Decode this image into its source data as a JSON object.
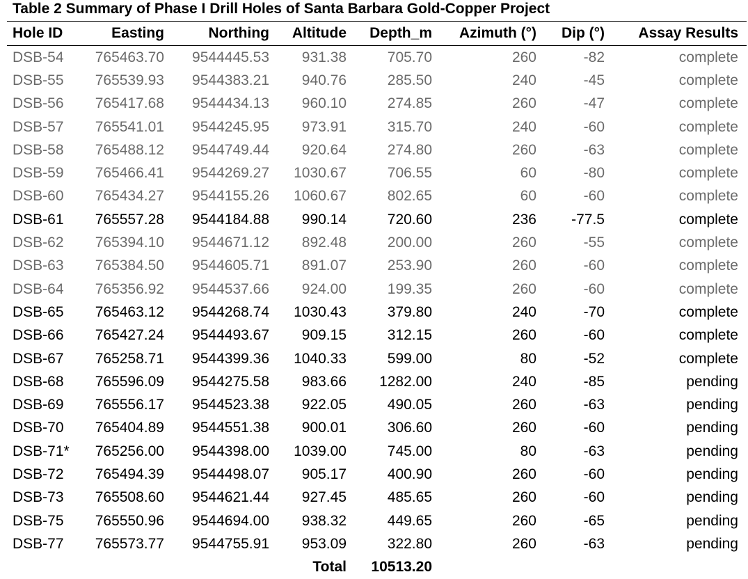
{
  "title": "Table 2 Summary of Phase I Drill Holes of Santa Barbara Gold-Copper Project",
  "headers": [
    "Hole ID",
    "Easting",
    "Northing",
    "Altitude",
    "Depth_m",
    "Azimuth (°)",
    "Dip (°)",
    "Assay Results"
  ],
  "rows": [
    {
      "id": "DSB-54",
      "easting": "765463.70",
      "northing": "9544445.53",
      "altitude": "931.38",
      "depth": "705.70",
      "azimuth": "260",
      "dip": "-82",
      "assay": "complete",
      "muted": true
    },
    {
      "id": "DSB-55",
      "easting": "765539.93",
      "northing": "9544383.21",
      "altitude": "940.76",
      "depth": "285.50",
      "azimuth": "240",
      "dip": "-45",
      "assay": "complete",
      "muted": true
    },
    {
      "id": "DSB-56",
      "easting": "765417.68",
      "northing": "9544434.13",
      "altitude": "960.10",
      "depth": "274.85",
      "azimuth": "260",
      "dip": "-47",
      "assay": "complete",
      "muted": true
    },
    {
      "id": "DSB-57",
      "easting": "765541.01",
      "northing": "9544245.95",
      "altitude": "973.91",
      "depth": "315.70",
      "azimuth": "240",
      "dip": "-60",
      "assay": "complete",
      "muted": true
    },
    {
      "id": "DSB-58",
      "easting": "765488.12",
      "northing": "9544749.44",
      "altitude": "920.64",
      "depth": "274.80",
      "azimuth": "260",
      "dip": "-63",
      "assay": "complete",
      "muted": true
    },
    {
      "id": "DSB-59",
      "easting": "765466.41",
      "northing": "9544269.27",
      "altitude": "1030.67",
      "depth": "706.55",
      "azimuth": "60",
      "dip": "-80",
      "assay": "complete",
      "muted": true
    },
    {
      "id": "DSB-60",
      "easting": "765434.27",
      "northing": "9544155.26",
      "altitude": "1060.67",
      "depth": "802.65",
      "azimuth": "60",
      "dip": "-60",
      "assay": "complete",
      "muted": true
    },
    {
      "id": "DSB-61",
      "easting": "765557.28",
      "northing": "9544184.88",
      "altitude": "990.14",
      "depth": "720.60",
      "azimuth": "236",
      "dip": "-77.5",
      "assay": "complete",
      "muted": false
    },
    {
      "id": "DSB-62",
      "easting": "765394.10",
      "northing": "9544671.12",
      "altitude": "892.48",
      "depth": "200.00",
      "azimuth": "260",
      "dip": "-55",
      "assay": "complete",
      "muted": true
    },
    {
      "id": "DSB-63",
      "easting": "765384.50",
      "northing": "9544605.71",
      "altitude": "891.07",
      "depth": "253.90",
      "azimuth": "260",
      "dip": "-60",
      "assay": "complete",
      "muted": true
    },
    {
      "id": "DSB-64",
      "easting": "765356.92",
      "northing": "9544537.66",
      "altitude": "924.00",
      "depth": "199.35",
      "azimuth": "260",
      "dip": "-60",
      "assay": "complete",
      "muted": true
    },
    {
      "id": "DSB-65",
      "easting": "765463.12",
      "northing": "9544268.74",
      "altitude": "1030.43",
      "depth": "379.80",
      "azimuth": "240",
      "dip": "-70",
      "assay": "complete",
      "muted": false
    },
    {
      "id": "DSB-66",
      "easting": "765427.24",
      "northing": "9544493.67",
      "altitude": "909.15",
      "depth": "312.15",
      "azimuth": "260",
      "dip": "-60",
      "assay": "complete",
      "muted": false
    },
    {
      "id": "DSB-67",
      "easting": "765258.71",
      "northing": "9544399.36",
      "altitude": "1040.33",
      "depth": "599.00",
      "azimuth": "80",
      "dip": "-52",
      "assay": "complete",
      "muted": false
    },
    {
      "id": "DSB-68",
      "easting": "765596.09",
      "northing": "9544275.58",
      "altitude": "983.66",
      "depth": "1282.00",
      "azimuth": "240",
      "dip": "-85",
      "assay": "pending",
      "muted": false
    },
    {
      "id": "DSB-69",
      "easting": "765556.17",
      "northing": "9544523.38",
      "altitude": "922.05",
      "depth": "490.05",
      "azimuth": "260",
      "dip": "-63",
      "assay": "pending",
      "muted": false
    },
    {
      "id": "DSB-70",
      "easting": "765404.89",
      "northing": "9544551.38",
      "altitude": "900.01",
      "depth": "306.60",
      "azimuth": "260",
      "dip": "-60",
      "assay": "pending",
      "muted": false
    },
    {
      "id": "DSB-71*",
      "easting": "765256.00",
      "northing": "9544398.00",
      "altitude": "1039.00",
      "depth": "745.00",
      "azimuth": "80",
      "dip": "-63",
      "assay": "pending",
      "muted": false
    },
    {
      "id": "DSB-72",
      "easting": "765494.39",
      "northing": "9544498.07",
      "altitude": "905.17",
      "depth": "400.90",
      "azimuth": "260",
      "dip": "-60",
      "assay": "pending",
      "muted": false
    },
    {
      "id": "DSB-73",
      "easting": "765508.60",
      "northing": "9544621.44",
      "altitude": "927.45",
      "depth": "485.65",
      "azimuth": "260",
      "dip": "-60",
      "assay": "pending",
      "muted": false
    },
    {
      "id": "DSB-75",
      "easting": "765550.96",
      "northing": "9544694.00",
      "altitude": "938.32",
      "depth": "449.65",
      "azimuth": "260",
      "dip": "-65",
      "assay": "pending",
      "muted": false
    },
    {
      "id": "DSB-77",
      "easting": "765573.77",
      "northing": "9544755.91",
      "altitude": "953.09",
      "depth": "322.80",
      "azimuth": "260",
      "dip": "-63",
      "assay": "pending",
      "muted": false
    }
  ],
  "total": {
    "label": "Total",
    "value": "10513.20"
  },
  "colors": {
    "muted_text": "#6b6b6b",
    "text": "#000000"
  }
}
